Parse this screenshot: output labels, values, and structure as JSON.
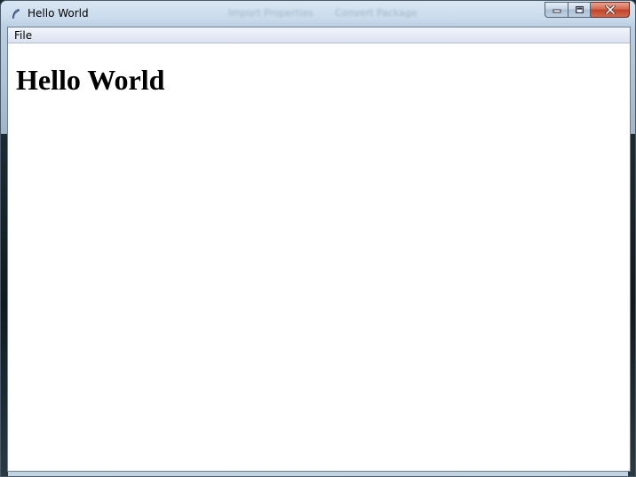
{
  "window": {
    "title": "Hello World",
    "ghost_taskbar_items": [
      "Import Properties",
      "Convert Package"
    ]
  },
  "menu": {
    "items": [
      {
        "label": "File"
      }
    ]
  },
  "content": {
    "heading": "Hello World"
  },
  "icons": {
    "app": "app-feather-icon",
    "minimize": "minimize-icon",
    "maximize": "maximize-icon",
    "close": "close-icon"
  },
  "colors": {
    "close_button": "#c7462d",
    "menubar": "#e4e9f5"
  }
}
